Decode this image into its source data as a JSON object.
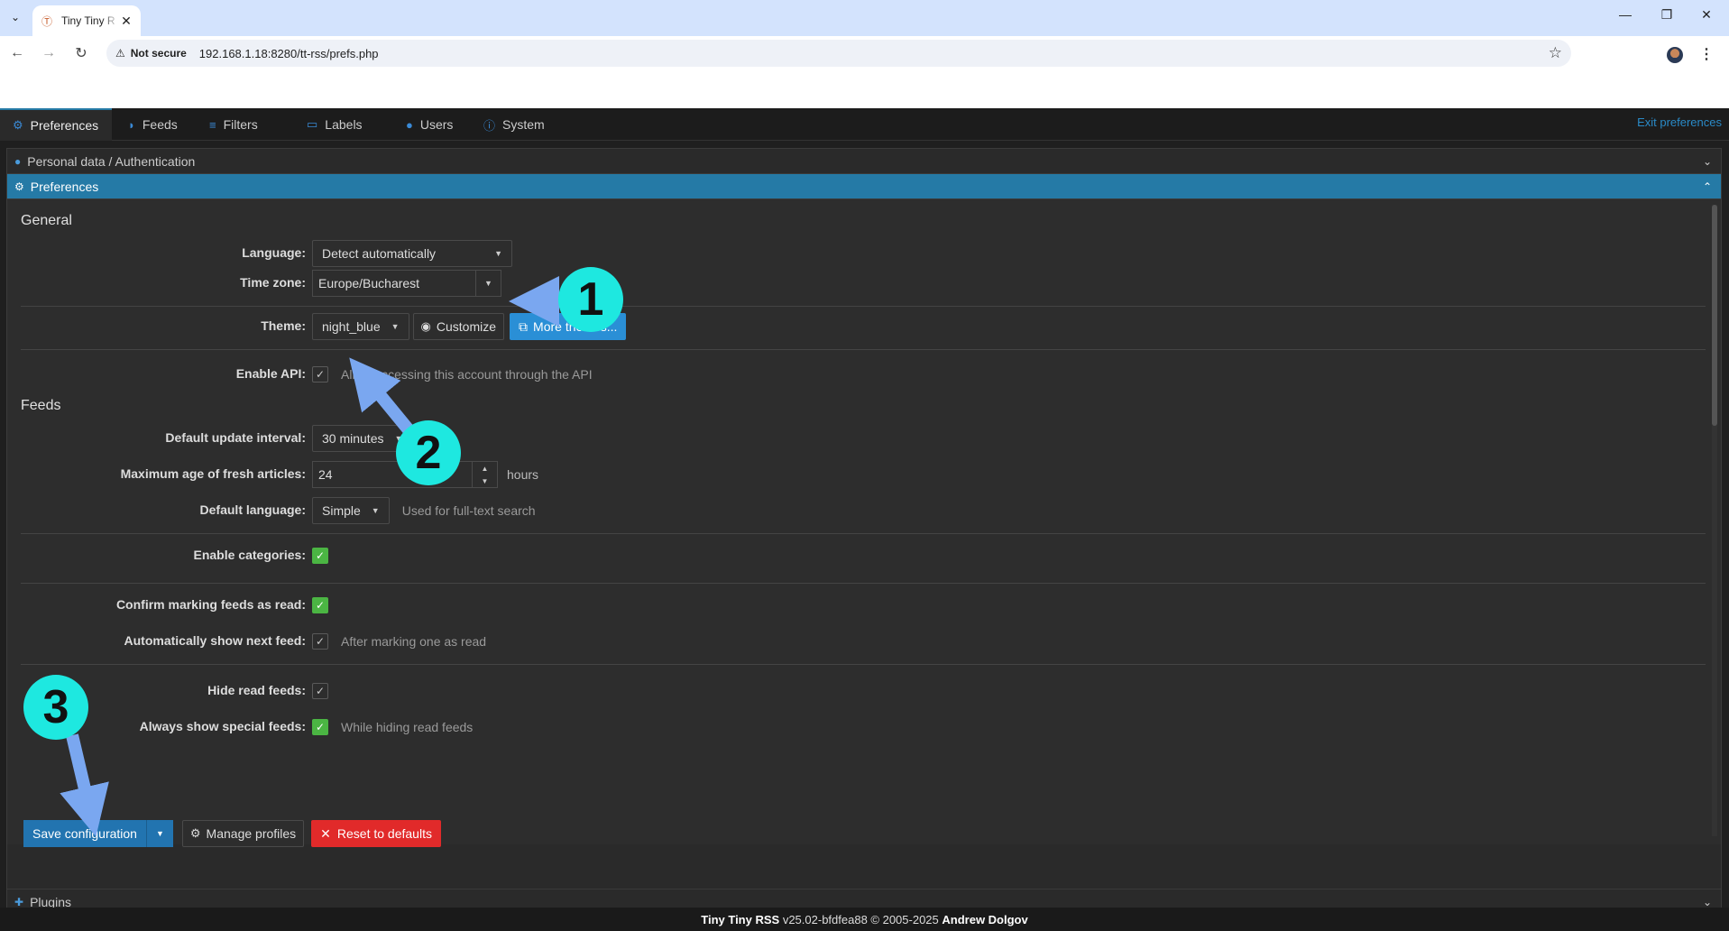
{
  "browser": {
    "tab_title": "Tiny Tiny R",
    "not_secure": "Not secure",
    "url": "192.168.1.18:8280/tt-rss/prefs.php"
  },
  "app_tabs": [
    {
      "label": "Preferences",
      "icon": "gear-icon"
    },
    {
      "label": "Feeds",
      "icon": "rss-icon"
    },
    {
      "label": "Filters",
      "icon": "filter-icon"
    },
    {
      "label": "Labels",
      "icon": "label-icon"
    },
    {
      "label": "Users",
      "icon": "user-icon"
    },
    {
      "label": "System",
      "icon": "info-icon"
    }
  ],
  "exit_preferences": "Exit preferences",
  "accordion": {
    "personal": "Personal data / Authentication",
    "preferences": "Preferences",
    "plugins": "Plugins"
  },
  "general": {
    "heading": "General",
    "language_label": "Language:",
    "language_value": "Detect automatically",
    "timezone_label": "Time zone:",
    "timezone_value": "Europe/Bucharest",
    "theme_label": "Theme:",
    "theme_value": "night_blue",
    "customize": "Customize",
    "more_themes": "More themes...",
    "api_label": "Enable API:",
    "api_hint": "Allow accessing this account through the API"
  },
  "feeds": {
    "heading": "Feeds",
    "update_label": "Default update interval:",
    "update_value": "30 minutes",
    "maxage_label": "Maximum age of fresh articles:",
    "maxage_value": "24",
    "maxage_unit": "hours",
    "lang_label": "Default language:",
    "lang_value": "Simple",
    "lang_hint": "Used for full-text search",
    "categories_label": "Enable categories:",
    "confirm_label": "Confirm marking feeds as read:",
    "autoshow_label": "Automatically show next feed:",
    "autoshow_hint": "After marking one as read",
    "hideread_label": "Hide read feeds:",
    "special_label": "Always show special feeds:",
    "special_hint": "While hiding read feeds"
  },
  "buttons": {
    "save": "Save configuration",
    "manage": "Manage profiles",
    "reset": "Reset to defaults"
  },
  "footer": {
    "app": "Tiny Tiny RSS",
    "version": "v25.02-bfdfea88 © 2005-2025",
    "author": "Andrew Dolgov"
  },
  "annotations": [
    "1",
    "2",
    "3"
  ],
  "colors": {
    "accent": "#257aa6",
    "marker": "#1ee8e0",
    "arrow": "#7aa7f0",
    "danger": "#e12a2a",
    "check": "#4bb543"
  }
}
